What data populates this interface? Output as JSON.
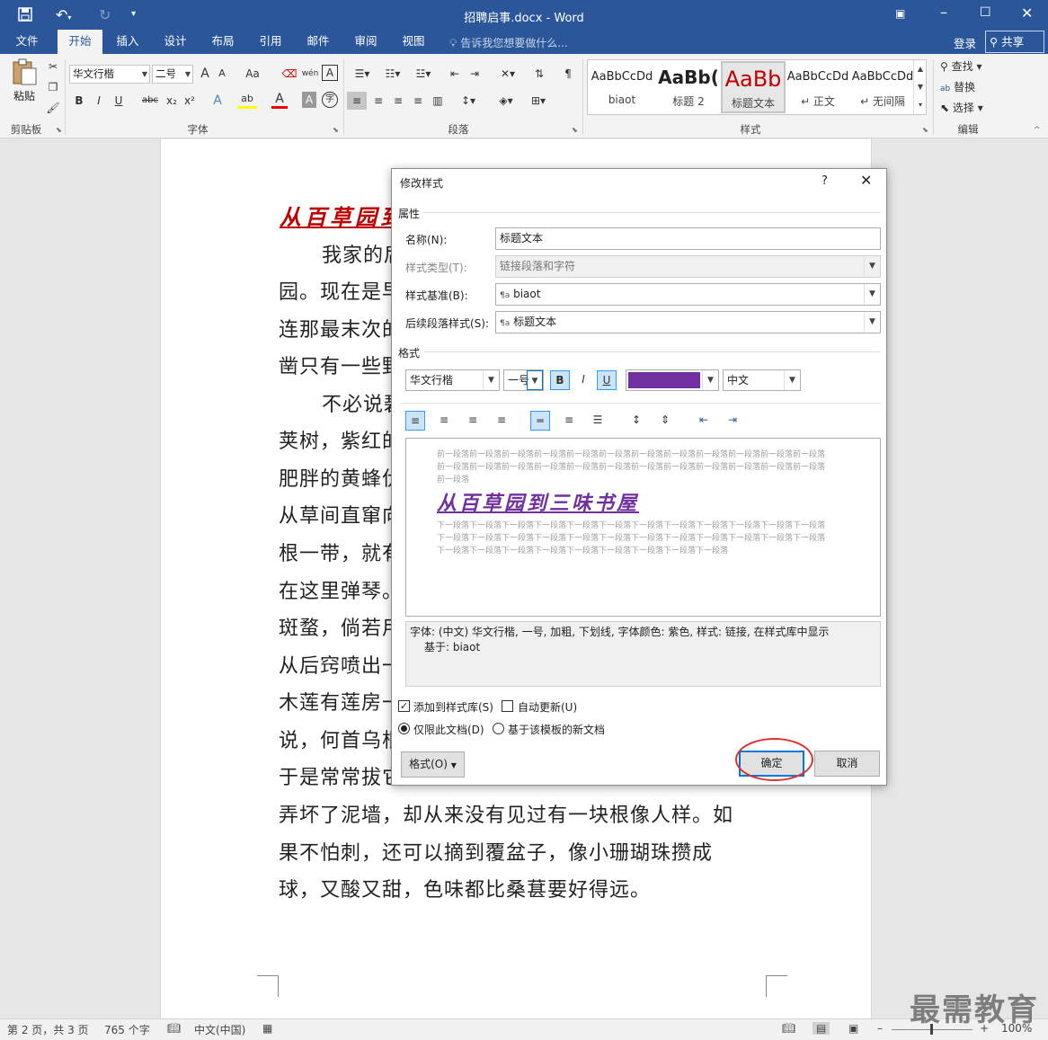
{
  "titlebar": {
    "title": "招聘启事.docx - Word"
  },
  "tabs": [
    "文件",
    "开始",
    "插入",
    "设计",
    "布局",
    "引用",
    "邮件",
    "审阅",
    "视图"
  ],
  "tell_me": "告诉我您想要做什么...",
  "account": {
    "login": "登录",
    "share": "共享"
  },
  "ribbon": {
    "clipboard": {
      "paste": "粘贴",
      "label": "剪贴板"
    },
    "font": {
      "name": "华文行楷",
      "size": "二号",
      "label": "字体",
      "grow": "A",
      "shrink": "A",
      "case": "Aa",
      "phonetic": "wén",
      "border_char": "A",
      "bold": "B",
      "italic": "I",
      "underline": "U",
      "strike": "abc",
      "sub": "x₂",
      "sup": "x²",
      "effects": "A",
      "highlight": "ab",
      "color": "A",
      "shade": "A",
      "enclose": "字"
    },
    "paragraph": {
      "label": "段落"
    },
    "styles": {
      "label": "样式",
      "items": [
        {
          "preview": "AaBbCcDd",
          "name": "biaot"
        },
        {
          "preview": "AaBb(",
          "name": "标题 2"
        },
        {
          "preview": "AaBb",
          "name": "标题文本"
        },
        {
          "preview": "AaBbCcDd",
          "name": "↵ 正文"
        },
        {
          "preview": "AaBbCcDd",
          "name": "↵ 无间隔"
        }
      ]
    },
    "editing": {
      "label": "编辑",
      "find": "查找",
      "replace": "替换",
      "select": "选择"
    }
  },
  "document": {
    "title": "从百草园到",
    "lines": [
      "我家的后",
      "园。现在是早",
      "连那最末次的",
      "凿只有一些野",
      "不必说碧",
      "荚树，紫红的",
      "肥胖的黄蜂伏",
      "从草间直窜向",
      "根一带，就有",
      "在这里弹琴。",
      "斑蝥，倘若用",
      "从后窍喷出一",
      "木莲有莲房一",
      "说，何首乌根",
      "于是常常拔它",
      "弄坏了泥墙，却从来没有见过有一块根像人样。如",
      "果不怕刺，还可以摘到覆盆子，像小珊瑚珠攒成",
      "球，又酸又甜，色味都比桑葚要好得远。"
    ]
  },
  "dialog": {
    "title": "修改样式",
    "help": "?",
    "section_props": "属性",
    "name_label": "名称(N):",
    "name_value": "标题文本",
    "type_label": "样式类型(T):",
    "type_value": "链接段落和字符",
    "based_label": "样式基准(B):",
    "based_value": "biaot",
    "follow_label": "后续段落样式(S):",
    "follow_value": "标题文本",
    "section_format": "格式",
    "font_name": "华文行楷",
    "font_size": "一号",
    "bold": "B",
    "italic": "I",
    "underline": "U",
    "font_color": "#7030a0",
    "script": "中文",
    "preview_prev": "前一段落前一段落前一段落前一段落前一段落前一段落前一段落前一段落前一段落前一段落前一段落前一段落前一段落前一段落前一段落前一段落前一段落前一段落前一段落前一段落前一段落前一段落前一段落前一段落前一段落",
    "preview_title": "从百草园到三味书屋",
    "preview_next": "下一段落下一段落下一段落下一段落下一段落下一段落下一段落下一段落下一段落下一段落下一段落下一段落下一段落下一段落下一段落下一段落下一段落下一段落下一段落下一段落下一段落下一段落下一段落下一段落下一段落下一段落下一段落下一段落下一段落下一段落下一段落下一段落下一段落",
    "description_line1": "字体: (中文) 华文行楷, 一号, 加粗, 下划线, 字体颜色: 紫色, 样式: 链接, 在样式库中显示",
    "description_line2": "基于: biaot",
    "add_to_gallery": "添加到样式库(S)",
    "auto_update": "自动更新(U)",
    "only_this_doc": "仅限此文档(D)",
    "new_docs_template": "基于该模板的新文档",
    "format_button": "格式(O)",
    "ok": "确定",
    "cancel": "取消"
  },
  "statusbar": {
    "page": "第 2 页，共 3 页",
    "words": "765 个字",
    "lang": "中文(中国)",
    "zoom": "100%"
  },
  "watermark": "最需教育"
}
